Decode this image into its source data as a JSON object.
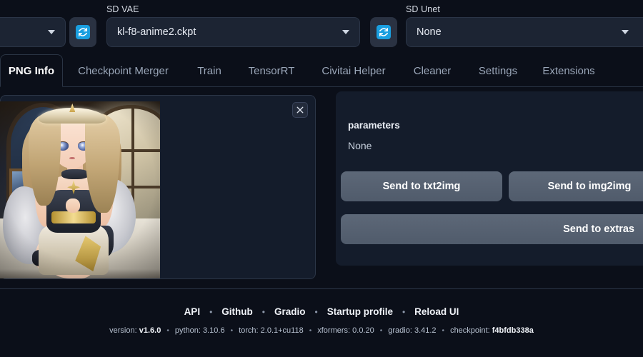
{
  "topbar": {
    "left_dropdown": {
      "value": "",
      "caret_icon": "chevron-down-icon"
    },
    "vae": {
      "label": "SD VAE",
      "value": "kl-f8-anime2.ckpt",
      "refresh_icon": "refresh-icon"
    },
    "unet": {
      "label": "SD Unet",
      "value": "None",
      "refresh_icon": "refresh-icon"
    }
  },
  "tabs": [
    {
      "label": "PNG Info",
      "active": true
    },
    {
      "label": "Checkpoint Merger",
      "active": false
    },
    {
      "label": "Train",
      "active": false
    },
    {
      "label": "TensorRT",
      "active": false
    },
    {
      "label": "Civitai Helper",
      "active": false
    },
    {
      "label": "Cleaner",
      "active": false
    },
    {
      "label": "Settings",
      "active": false
    },
    {
      "label": "Extensions",
      "active": false
    }
  ],
  "image_panel": {
    "close_icon": "close-icon",
    "alt": "anime girl portrait preview"
  },
  "params": {
    "title": "parameters",
    "value": "None",
    "buttons": {
      "txt2img": "Send to txt2img",
      "img2img": "Send to img2img",
      "extras": "Send to extras"
    }
  },
  "footer": {
    "links": [
      "API",
      "Github",
      "Gradio",
      "Startup profile",
      "Reload UI"
    ],
    "separator": "•",
    "version_items": [
      {
        "key": "version: ",
        "val": "v1.6.0"
      },
      {
        "key": "python: ",
        "val": "3.10.6"
      },
      {
        "key": "torch: ",
        "val": "2.0.1+cu118"
      },
      {
        "key": "xformers: ",
        "val": "0.0.20"
      },
      {
        "key": "gradio: ",
        "val": "3.41.2"
      },
      {
        "key": "checkpoint: ",
        "val": "f4bfdb338a"
      }
    ]
  },
  "colors": {
    "page_bg": "#0b0f19",
    "panel_bg": "#141c2b",
    "field_bg": "#1c2433",
    "border": "#2b3547",
    "accent_blue": "#1a9fe0",
    "button_gray": "#5d6878",
    "text_primary": "#e6eaf2",
    "text_muted": "#9aa6b8"
  }
}
